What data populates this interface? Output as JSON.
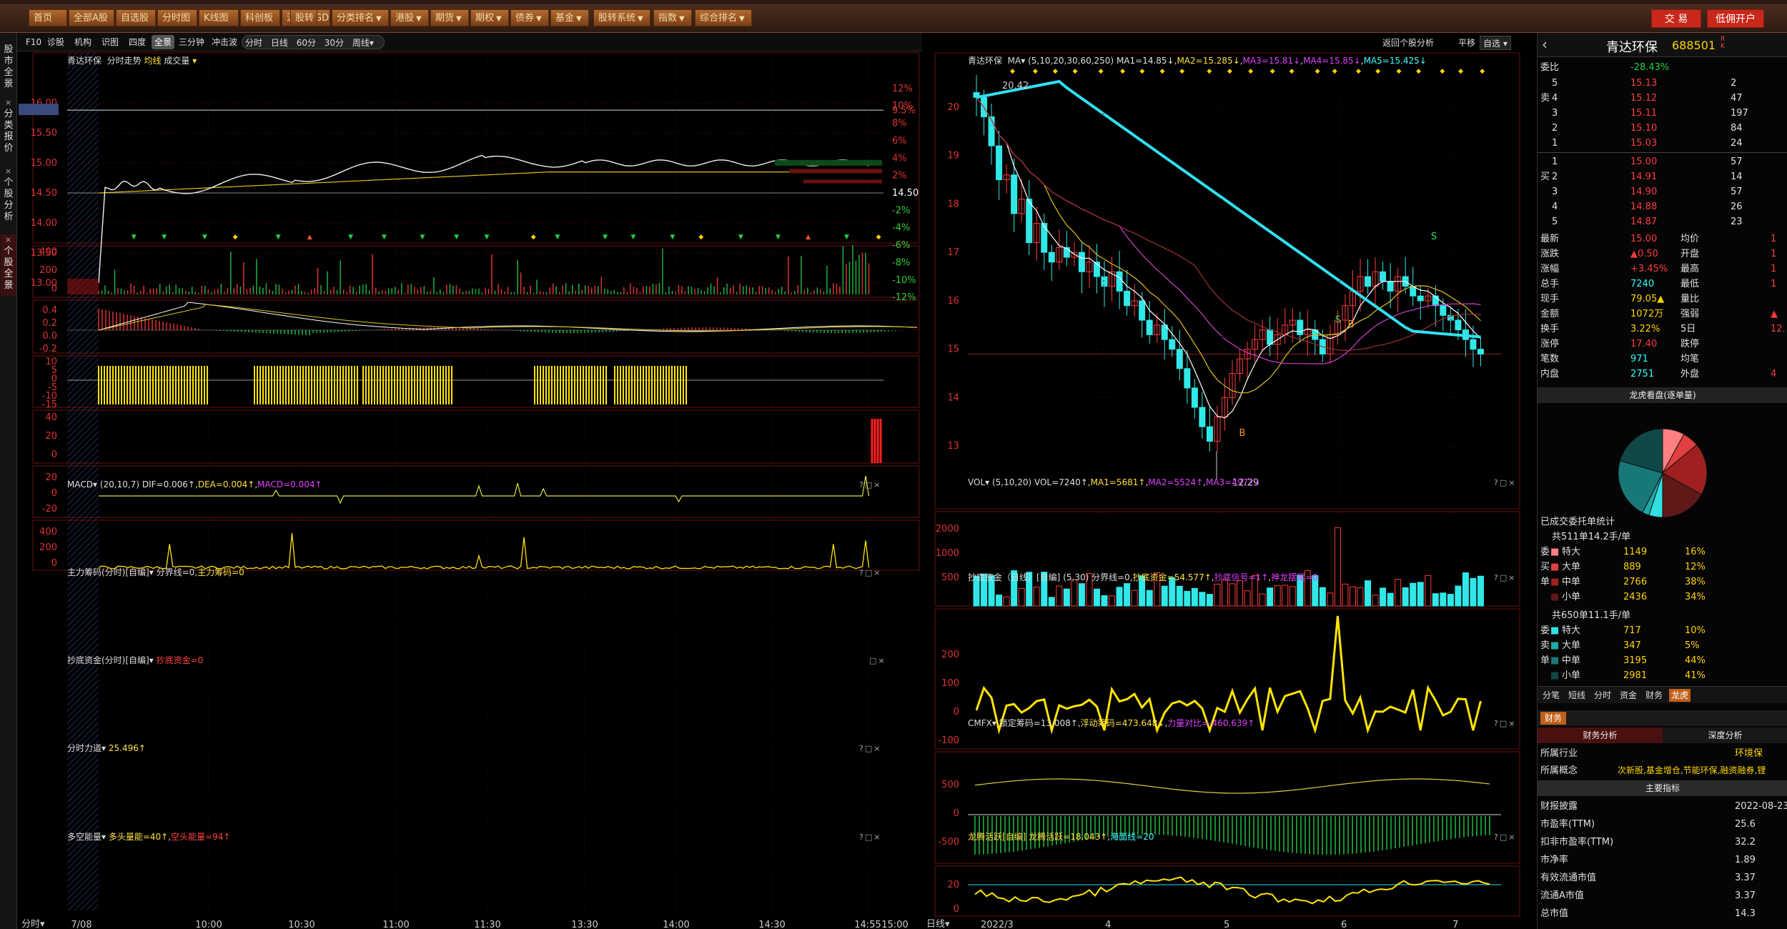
{
  "topmenu": {
    "items": [
      "首页",
      "全部A股",
      "自选股",
      "分时图",
      "K线图",
      "科创板",
      "沪伦通GDR",
      "股转",
      "分类排名",
      "港股",
      "期货",
      "期权",
      "债券",
      "基金",
      "股转系统",
      "指数",
      "综合排名"
    ],
    "trade": "交 易",
    "open": "低佣开户"
  },
  "vtabs": [
    "股市全景",
    "分类报价",
    "个股分析",
    "个股全景"
  ],
  "left_tabs": [
    "F10",
    "诊股",
    "机构",
    "识图",
    "四度",
    "全景",
    "三分钟",
    "冲击波"
  ],
  "left_tabs2": [
    "分时",
    "日线",
    "60分",
    "30分",
    "周线"
  ],
  "chart_info": {
    "title": "青达环保",
    "sub": "分时走势",
    "avg": "均线",
    "vol": "成交量"
  },
  "left_axis": [
    "16.00",
    "15.88",
    "15.50",
    "15.00",
    "14.50",
    "14.00",
    "13.50",
    "13.00"
  ],
  "right_axis": [
    "12%",
    "10%",
    "9.5%",
    "8%",
    "6%",
    "4%",
    "2%",
    "14.50",
    "-2%",
    "-4%",
    "-6%",
    "-8%",
    "-10%",
    "-12%"
  ],
  "vol_axis": [
    "400",
    "200",
    "0"
  ],
  "macd": {
    "name": "MACD",
    "params": "(20,10,7)",
    "dif": "DIF=0.006↑",
    "dea": "DEA=0.004↑",
    "macd": "MACD=0.004↑",
    "axis": [
      "0.4",
      "0.2",
      "0.0",
      "-0.2"
    ]
  },
  "zlcm": {
    "name": "主力筹码(分时)[自编]",
    "line": "分界线=0",
    "val": "主力筹码=0",
    "axis": [
      "10",
      "5",
      "0",
      "-5",
      "-10",
      "-15"
    ]
  },
  "cdzj": {
    "name": "抄底资金(分时)[自编]",
    "val": "抄底资金=0",
    "axis": [
      "40",
      "20",
      "0"
    ]
  },
  "fsld": {
    "name": "分时力道",
    "val": "25.496↑",
    "axis": [
      "20",
      "0",
      "-20"
    ]
  },
  "dknl": {
    "name": "多空能量",
    "a": "多头量能=40↑",
    "b": "空头能量=94↑",
    "axis": [
      "400",
      "200",
      "0"
    ]
  },
  "time_axis": [
    "7/08",
    "10:00",
    "10:30",
    "11:00",
    "11:30",
    "13:30",
    "14:00",
    "14:30",
    "14:55",
    "15:00"
  ],
  "foot_left": "分时",
  "kline": {
    "title": "青达环保",
    "ma": "MA",
    "params": "(5,10,20,30,60,250)",
    "ma1": "MA1=14.85↓",
    "ma2": "MA2=15.285↓",
    "ma3": "MA3=15.81↓",
    "ma4": "MA4=15.85↓",
    "ma5": "MA5=15.425↓",
    "axis": [
      "20",
      "19",
      "18",
      "17",
      "16",
      "15",
      "14",
      "13"
    ],
    "high": "20.42",
    "low": "12.29",
    "back": "返回个股分析",
    "flat": "平移",
    "self": "自选",
    "markS": "S",
    "markB": "B"
  },
  "vol": {
    "name": "VOL",
    "params": "(5,10,20)",
    "v": "VOL=7240↑",
    "m1": "MA1=5681↑",
    "m2": "MA2=5524↑",
    "m3": "MA3=4972↓",
    "axis": [
      "2000",
      "1000",
      "500"
    ]
  },
  "cdzj2": {
    "name": "抄底资金（日线）[自编]",
    "params": "(5,30)",
    "a": "分界线=0",
    "b": "抄底资金=54.577↑",
    "c": "抄底信号=1↑",
    "d": "神龙摆尾=0",
    "axis": [
      "200",
      "100",
      "0",
      "-100"
    ]
  },
  "cmfx": {
    "name": "CMFX",
    "a": "锁定筹码=13.008↑",
    "b": "浮动筹码=473.648↓",
    "c": "力量对比=-460.639↑",
    "axis": [
      "500",
      "0",
      "-500"
    ]
  },
  "lths": {
    "name": "龙腾活跃[自编]",
    "a": "龙腾活跃=18.043↑",
    "b": "海面线=20",
    "axis": [
      "20",
      "0"
    ]
  },
  "date_axis": [
    "2022/3",
    "4",
    "5",
    "6",
    "7"
  ],
  "foot_right": "日线",
  "stock": {
    "name": "青达环保",
    "code": "688501",
    "weibi_label": "委比",
    "weibi": "-28.43%"
  },
  "asks": [
    {
      "l": "5",
      "p": "15.13",
      "v": "2"
    },
    {
      "l": "4",
      "p": "15.12",
      "v": "47"
    },
    {
      "l": "3",
      "p": "15.11",
      "v": "197"
    },
    {
      "l": "2",
      "p": "15.10",
      "v": "84"
    },
    {
      "l": "1",
      "p": "15.03",
      "v": "24"
    }
  ],
  "bids": [
    {
      "l": "1",
      "p": "15.00",
      "v": "57"
    },
    {
      "l": "2",
      "p": "14.91",
      "v": "14"
    },
    {
      "l": "3",
      "p": "14.90",
      "v": "57"
    },
    {
      "l": "4",
      "p": "14.88",
      "v": "26"
    },
    {
      "l": "5",
      "p": "14.87",
      "v": "23"
    }
  ],
  "quote": [
    {
      "a": "最新",
      "b": "15.00",
      "c": "均价",
      "d": "1"
    },
    {
      "a": "涨跌",
      "b": "▲0.50",
      "c": "开盘",
      "d": "1"
    },
    {
      "a": "涨幅",
      "b": "+3.45%",
      "c": "最高",
      "d": "1"
    },
    {
      "a": "总手",
      "b": "7240",
      "c": "最低",
      "d": "1"
    },
    {
      "a": "现手",
      "b": "79.05▲",
      "c": "量比",
      "d": ""
    },
    {
      "a": "金额",
      "b": "1072万",
      "c": "强弱",
      "d": "▲"
    },
    {
      "a": "换手",
      "b": "3.22%",
      "c": "5日",
      "d": "12."
    },
    {
      "a": "涨停",
      "b": "17.40",
      "c": "跌停",
      "d": ""
    },
    {
      "a": "笔数",
      "b": "971",
      "c": "均笔",
      "d": ""
    },
    {
      "a": "内盘",
      "b": "2751",
      "c": "外盘",
      "d": "4"
    }
  ],
  "lhk": {
    "title": "龙虎看盘(逐单量)",
    "done": "已成交委托单统计",
    "buy_total": "共511单14.2手/单",
    "sell_total": "共650单11.1手/单"
  },
  "buy_rows": [
    {
      "s": "委",
      "n": "特大",
      "v": "1149",
      "p": "16%",
      "c": "#ff8080"
    },
    {
      "s": "买",
      "n": "大单",
      "v": "889",
      "p": "12%",
      "c": "#e04040"
    },
    {
      "s": "单",
      "n": "中单",
      "v": "2766",
      "p": "38%",
      "c": "#a02020"
    },
    {
      "s": "",
      "n": "小单",
      "v": "2436",
      "p": "34%",
      "c": "#601818"
    }
  ],
  "sell_rows": [
    {
      "s": "委",
      "n": "特大",
      "v": "717",
      "p": "10%",
      "c": "#30e0e0"
    },
    {
      "s": "卖",
      "n": "大单",
      "v": "347",
      "p": "5%",
      "c": "#20a8a8"
    },
    {
      "s": "单",
      "n": "中单",
      "v": "3195",
      "p": "44%",
      "c": "#187878"
    },
    {
      "s": "",
      "n": "小单",
      "v": "2981",
      "p": "41%",
      "c": "#104848"
    }
  ],
  "pie": [
    0.16,
    0.12,
    0.38,
    0.34,
    0.1,
    0.05,
    0.44,
    0.41
  ],
  "bottom_tabs": [
    "分笔",
    "短线",
    "分时",
    "资金",
    "财务",
    "龙虎"
  ],
  "fin": {
    "tab": "财务",
    "t1": "财务分析",
    "t2": "深度分析",
    "industry_l": "所属行业",
    "industry_v": "环境保",
    "concept_l": "所属概念",
    "concept_v": "次新股,基金增仓,节能环保,融资融券,锂",
    "main": "主要指标",
    "rows": [
      {
        "a": "财报披露",
        "b": "2022-08-23"
      },
      {
        "a": "市盈率(TTM)",
        "b": "25.6"
      },
      {
        "a": "扣非市盈率(TTM)",
        "b": "32.2"
      },
      {
        "a": "市净率",
        "b": "1.89"
      },
      {
        "a": "有效流通市值",
        "b": "3.37"
      },
      {
        "a": "流通A市值",
        "b": "3.37"
      },
      {
        "a": "总市值",
        "b": "14.3"
      }
    ]
  },
  "colors": {
    "up": "#ff3b3b",
    "down": "#20d040",
    "accent": "#ffd400",
    "bg": "#000000"
  }
}
